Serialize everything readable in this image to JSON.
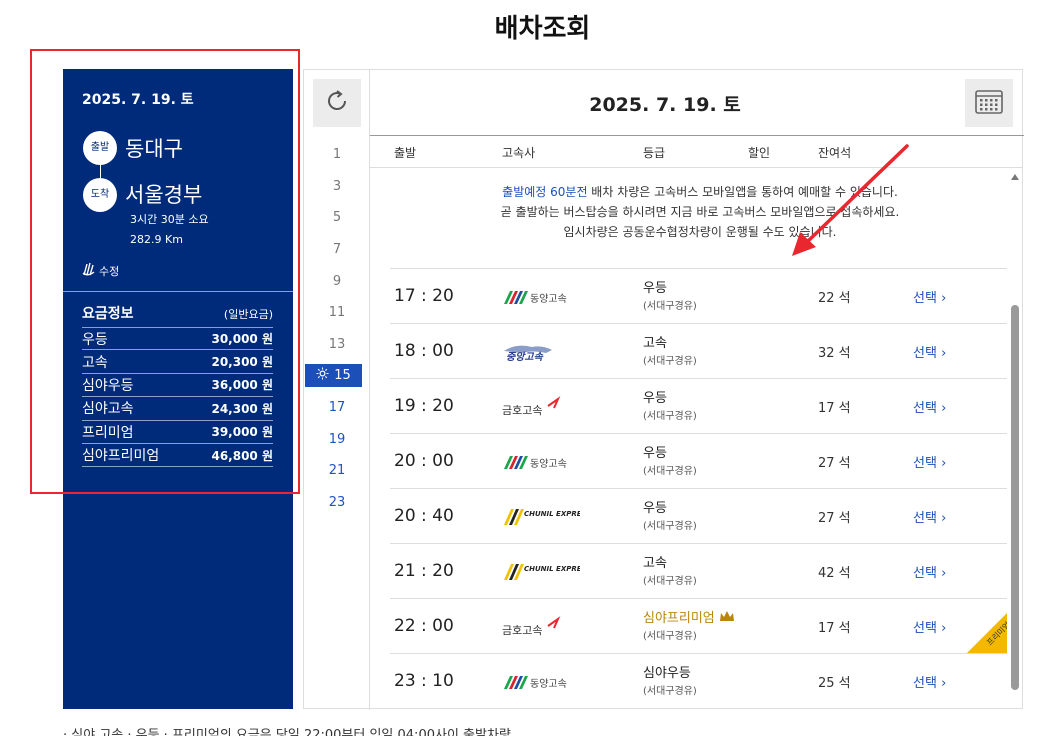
{
  "page": {
    "title": "배차조회"
  },
  "left_panel": {
    "date": "2025. 7. 19. 토",
    "departure_badge": "출발",
    "departure": "동대구",
    "arrival_badge": "도착",
    "arrival": "서울경부",
    "duration": "3시간 30분 소요",
    "distance": "282.9 Km",
    "edit_label": "수정",
    "fare_title": "요금정보",
    "fare_note": "(일반요금)",
    "fares": [
      {
        "grade": "우등",
        "price": "30,000 원"
      },
      {
        "grade": "고속",
        "price": "20,300 원"
      },
      {
        "grade": "심야우등",
        "price": "36,000 원"
      },
      {
        "grade": "심야고속",
        "price": "24,300 원"
      },
      {
        "grade": "프리미엄",
        "price": "39,000 원"
      },
      {
        "grade": "심야프리미엄",
        "price": "46,800 원"
      }
    ]
  },
  "main": {
    "date": "2025. 7. 19. 토",
    "hours": [
      "1",
      "3",
      "5",
      "7",
      "9",
      "11",
      "13",
      "15",
      "17",
      "19",
      "21",
      "23"
    ],
    "active_hour": "15",
    "headers": {
      "depart": "출발",
      "company": "고속사",
      "grade": "등급",
      "discount": "할인",
      "seats": "잔여석"
    },
    "notice": {
      "line1_highlight": "출발예정 60분전",
      "line1_rest": " 배차 차량은 고속버스 모바일앱을 통하여 예매할 수 있습니다.",
      "line2": "곧 출발하는 버스탑승을 하시려면 지금 바로 고속버스 모바일앱으로 접속하세요.",
      "line3": "임시차량은 공동운수협정차량이 운행될 수도 있습니다."
    },
    "premium_tag": "프리미엄",
    "rows": [
      {
        "time": "17 : 20",
        "company": "동양고속",
        "logo": "dongyang",
        "grade": "우등",
        "route": "(서대구경유)",
        "seats": "22 석",
        "select": "선택"
      },
      {
        "time": "18 : 00",
        "company": "중앙고속",
        "logo": "jungang",
        "grade": "고속",
        "route": "(서대구경유)",
        "seats": "32 석",
        "select": "선택"
      },
      {
        "time": "19 : 20",
        "company": "금호고속",
        "logo": "kumho",
        "grade": "우등",
        "route": "(서대구경유)",
        "seats": "17 석",
        "select": "선택"
      },
      {
        "time": "20 : 00",
        "company": "동양고속",
        "logo": "dongyang",
        "grade": "우등",
        "route": "(서대구경유)",
        "seats": "27 석",
        "select": "선택"
      },
      {
        "time": "20 : 40",
        "company": "CHUNIL EXPRESS",
        "logo": "chunil",
        "grade": "우등",
        "route": "(서대구경유)",
        "seats": "27 석",
        "select": "선택"
      },
      {
        "time": "21 : 20",
        "company": "CHUNIL EXPRESS",
        "logo": "chunil",
        "grade": "고속",
        "route": "(서대구경유)",
        "seats": "42 석",
        "select": "선택"
      },
      {
        "time": "22 : 00",
        "company": "금호고속",
        "logo": "kumho",
        "grade": "심야프리미엄",
        "route": "(서대구경유)",
        "seats": "17 석",
        "select": "선택",
        "premium": true
      },
      {
        "time": "23 : 10",
        "company": "동양고속",
        "logo": "dongyang",
        "grade": "심야우등",
        "route": "(서대구경유)",
        "seats": "25 석",
        "select": "선택"
      }
    ]
  },
  "footnote": "· 심야 고속 · 우등 · 프리미엄의 요금은 당일 22:00부터 익일 04:00사이 출발차량",
  "colors": {
    "panel_navy": "#002a7a",
    "accent_blue": "#1d4fb8",
    "highlight_red": "#e8272e",
    "premium_gold": "#b8860b"
  }
}
